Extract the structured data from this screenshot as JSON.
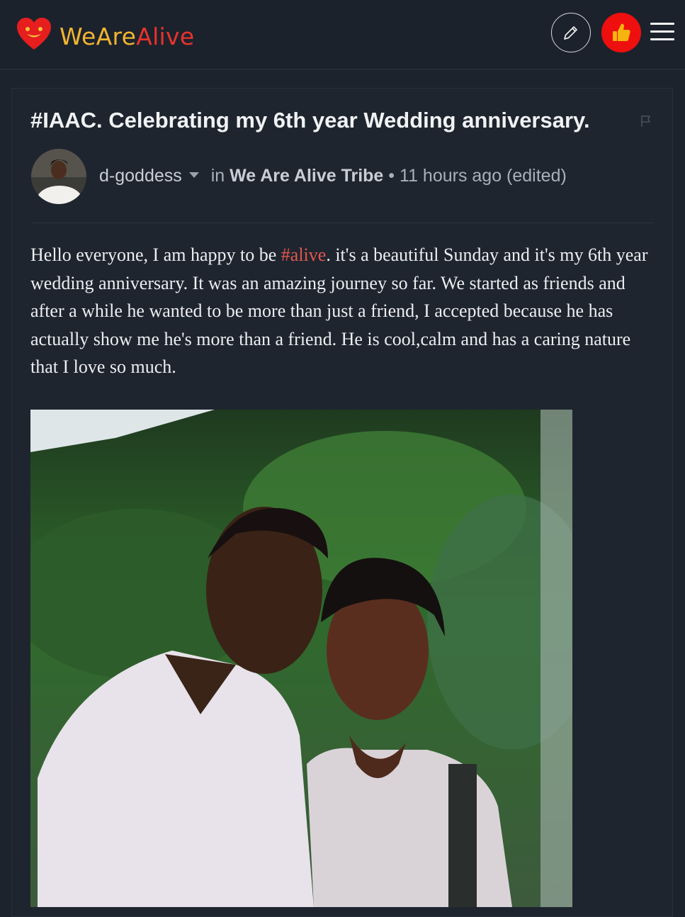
{
  "header": {
    "logo_part1": "WeAre",
    "logo_part2": "Alive",
    "brand_yellow": "#f0b431",
    "brand_red": "#e8332c",
    "icons": [
      "heart-logo-icon",
      "pencil-icon",
      "thumbs-up-icon",
      "hamburger-menu-icon"
    ]
  },
  "post": {
    "title": "#IAAC. Celebrating my 6th year Wedding anniversary.",
    "author": "d-goddess",
    "in_label": "in",
    "community": "We Are Alive Tribe",
    "separator": "•",
    "time": "11 hours ago (edited)",
    "body_before_tag": "Hello everyone, I am happy to be ",
    "body_tag": "#alive",
    "body_after_tag": ". it's a beautiful Sunday and it's my 6th year wedding anniversary. It was an amazing journey so far. We started as friends and after a while he wanted to be more than just a friend, I accepted because he has actually show me he's more than a friend. He is cool,calm and has a caring nature that I love so much.",
    "tag_color": "#e4564d"
  }
}
